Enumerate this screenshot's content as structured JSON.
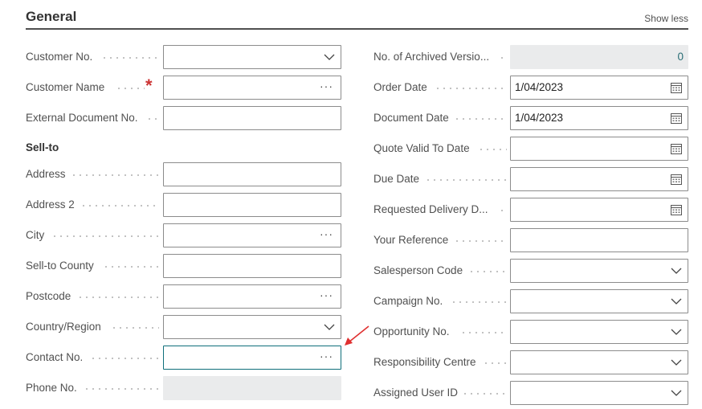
{
  "header": {
    "title": "General",
    "toggle_label": "Show less"
  },
  "left": {
    "customer_no": {
      "label": "Customer No.",
      "value": ""
    },
    "customer_name": {
      "label": "Customer Name",
      "value": "",
      "required_mark": "*"
    },
    "external_doc_no": {
      "label": "External Document No.",
      "value": ""
    },
    "sell_to_heading": "Sell-to",
    "address": {
      "label": "Address",
      "value": ""
    },
    "address2": {
      "label": "Address 2",
      "value": ""
    },
    "city": {
      "label": "City",
      "value": ""
    },
    "county": {
      "label": "Sell-to County",
      "value": ""
    },
    "postcode": {
      "label": "Postcode",
      "value": ""
    },
    "country": {
      "label": "Country/Region",
      "value": ""
    },
    "contact_no": {
      "label": "Contact No.",
      "value": ""
    },
    "phone_no": {
      "label": "Phone No.",
      "value": ""
    }
  },
  "right": {
    "archived_versions": {
      "label": "No. of Archived Versio...",
      "value": "0"
    },
    "order_date": {
      "label": "Order Date",
      "value": "1/04/2023"
    },
    "document_date": {
      "label": "Document Date",
      "value": "1/04/2023"
    },
    "quote_valid_to": {
      "label": "Quote Valid To Date",
      "value": ""
    },
    "due_date": {
      "label": "Due Date",
      "value": ""
    },
    "requested_delivery": {
      "label": "Requested Delivery D...",
      "value": ""
    },
    "your_reference": {
      "label": "Your Reference",
      "value": ""
    },
    "salesperson_code": {
      "label": "Salesperson Code",
      "value": ""
    },
    "campaign_no": {
      "label": "Campaign No.",
      "value": ""
    },
    "opportunity_no": {
      "label": "Opportunity No.",
      "value": ""
    },
    "responsibility_centre": {
      "label": "Responsibility Centre",
      "value": ""
    },
    "assigned_user_id": {
      "label": "Assigned User ID",
      "value": ""
    }
  },
  "icons": {
    "dropdown": "chevron-down-icon",
    "lookup": "ellipsis-icon",
    "date": "calendar-icon",
    "annotation": "red-arrow-icon"
  },
  "colors": {
    "focus_border": "#0f6f7b",
    "required": "#cc3333",
    "disabled_bg": "#eaebec",
    "annotation_arrow": "#e03030"
  }
}
